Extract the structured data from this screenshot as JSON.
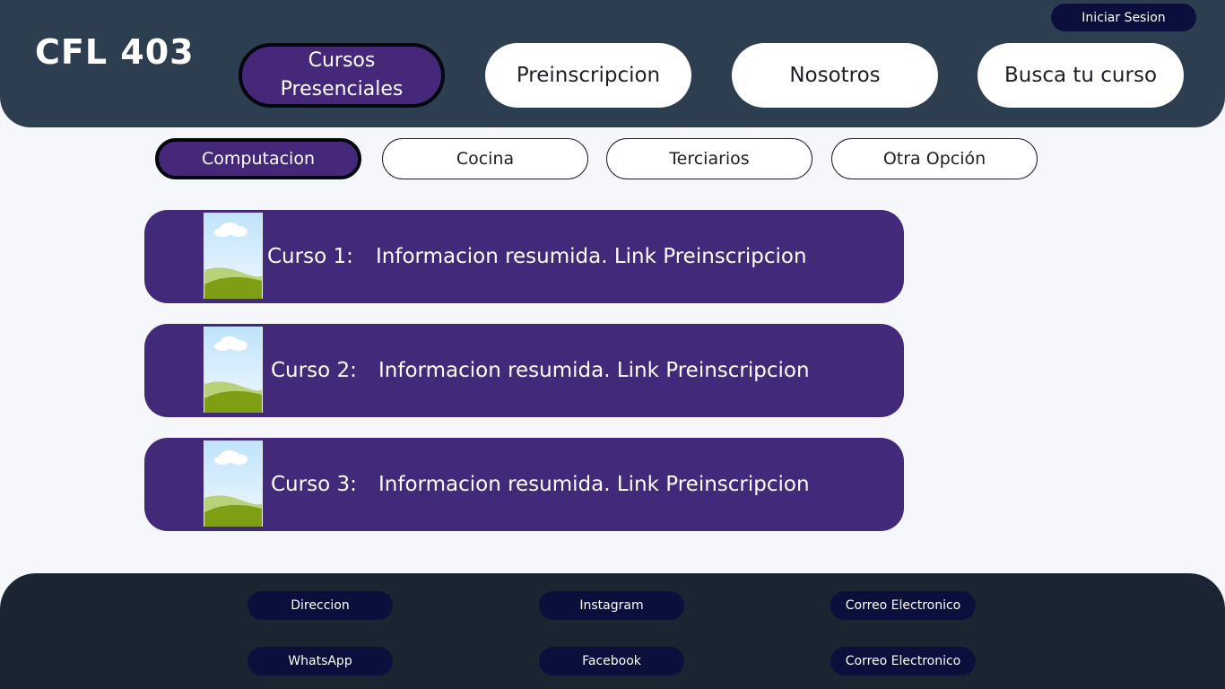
{
  "header": {
    "brand": "CFL 403",
    "login_label": "Iniciar Sesion",
    "nav": [
      {
        "label": "Cursos Presenciales",
        "active": true
      },
      {
        "label": "Preinscripcion",
        "active": false
      },
      {
        "label": "Nosotros",
        "active": false
      },
      {
        "label": "Busca tu curso",
        "active": false
      }
    ]
  },
  "categories": [
    {
      "label": "Computacion",
      "active": true
    },
    {
      "label": "Cocina",
      "active": false
    },
    {
      "label": "Terciarios",
      "active": false
    },
    {
      "label": "Otra Opción",
      "active": false
    }
  ],
  "courses": [
    {
      "title": "Curso 1:",
      "info": "Informacion resumida. Link Preinscripcion",
      "thumbnail_icon": "landscape-image-icon"
    },
    {
      "title": "Curso 2:",
      "info": "Informacion resumida. Link Preinscripcion",
      "thumbnail_icon": "landscape-image-icon"
    },
    {
      "title": "Curso 3:",
      "info": "Informacion resumida. Link Preinscripcion",
      "thumbnail_icon": "landscape-image-icon"
    }
  ],
  "footer": {
    "links": [
      [
        "Direccion",
        "Instagram",
        "Correo Electronico"
      ],
      [
        "WhatsApp",
        "Facebook",
        "Correo Electronico"
      ]
    ]
  },
  "colors": {
    "header_bg": "#2d3e50",
    "accent_purple": "#45287a",
    "dark_navy": "#0b0f3b",
    "footer_bg": "#1b2531",
    "page_bg": "#f5f7fa"
  }
}
